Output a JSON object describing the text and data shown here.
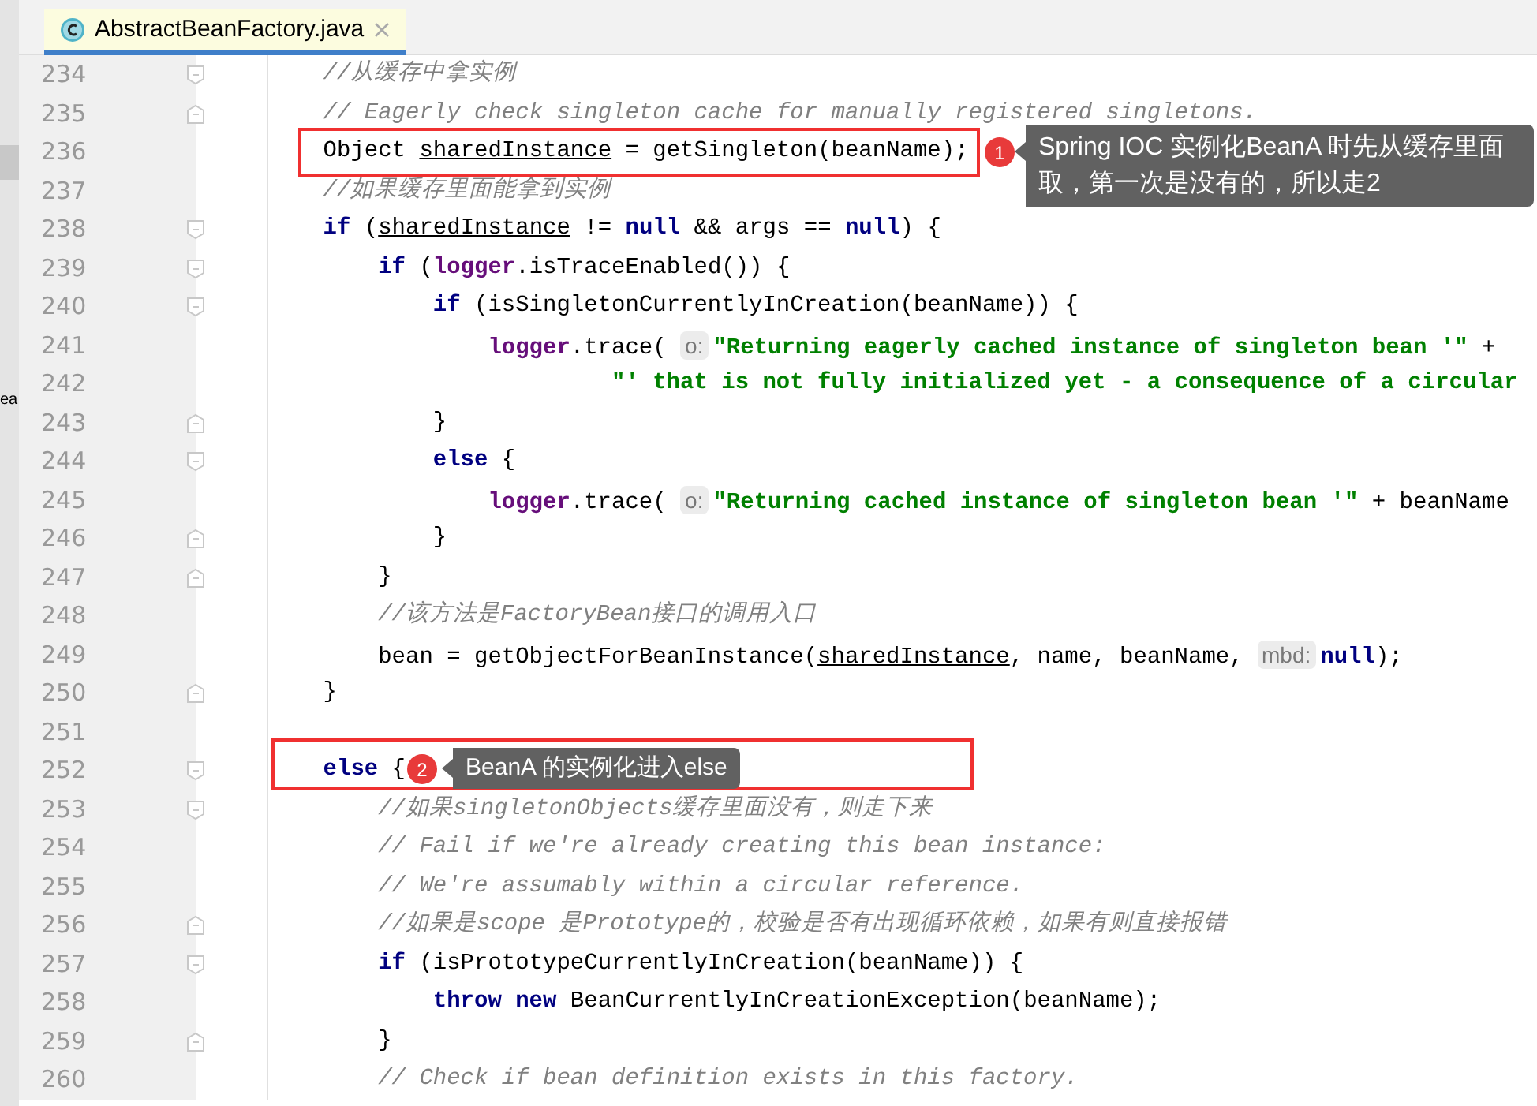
{
  "project_panel": {
    "text": "ea"
  },
  "tabs": [
    {
      "label": "AbstractBeanFactory.java",
      "selected": true
    }
  ],
  "lines": [
    {
      "number": "234",
      "kind": "block_start",
      "tokens": [
        {
          "kind": "comment",
          "text": "//从缓存中拿实例"
        }
      ]
    },
    {
      "number": "235",
      "kind": "block_end",
      "tokens": [
        {
          "kind": "comment",
          "text": "// Eagerly check singleton cache for manually registered singletons."
        }
      ]
    },
    {
      "number": "236",
      "kind": "code",
      "tokens": [
        {
          "kind": "plain",
          "text": "Object "
        },
        {
          "kind": "var",
          "text": "sharedInstance"
        },
        {
          "kind": "plain",
          "text": " = getSingleton(beanName);"
        }
      ]
    },
    {
      "number": "237",
      "kind": "code",
      "tokens": [
        {
          "kind": "comment",
          "text": "//如果缓存里面能拿到实例"
        }
      ]
    },
    {
      "number": "238",
      "kind": "block_start",
      "tokens": [
        {
          "kind": "keyword",
          "text": "if"
        },
        {
          "kind": "plain",
          "text": " ("
        },
        {
          "kind": "var",
          "text": "sharedInstance"
        },
        {
          "kind": "plain",
          "text": " != "
        },
        {
          "kind": "keyword",
          "text": "null"
        },
        {
          "kind": "plain",
          "text": " && args == "
        },
        {
          "kind": "keyword",
          "text": "null"
        },
        {
          "kind": "plain",
          "text": ") {"
        }
      ],
      "children": [
        {
          "number": "239",
          "kind": "block_start",
          "tokens": [
            {
              "kind": "keyword",
              "text": "if"
            },
            {
              "kind": "plain",
              "text": " ("
            },
            {
              "kind": "field",
              "text": "logger"
            },
            {
              "kind": "plain",
              "text": ".isTraceEnabled()) {"
            }
          ],
          "children": [
            {
              "number": "240",
              "kind": "block_start",
              "tokens": [
                {
                  "kind": "keyword",
                  "text": "if"
                },
                {
                  "kind": "plain",
                  "text": " (isSingletonCurrentlyInCreation(beanName)) {"
                }
              ],
              "children": [
                {
                  "number": "241",
                  "kind": "code",
                  "tokens": [
                    {
                      "kind": "field",
                      "text": "logger"
                    },
                    {
                      "kind": "plain",
                      "text": ".trace( "
                    },
                    {
                      "kind": "hint",
                      "text": "o:"
                    },
                    {
                      "kind": "string",
                      "text": "\"Returning eagerly cached instance of singleton bean '\""
                    },
                    {
                      "kind": "plain",
                      "text": " +"
                    }
                  ]
                },
                {
                  "number": "242",
                  "kind": "continuation",
                  "tokens": [
                    {
                      "kind": "string",
                      "text": "\"' that is not fully initialized yet - a consequence of a circular"
                    }
                  ]
                }
              ]
            },
            {
              "number": "243",
              "kind": "block_end",
              "tokens": [
                {
                  "kind": "plain",
                  "text": "}"
                }
              ]
            },
            {
              "number": "244",
              "kind": "block_start",
              "tokens": [
                {
                  "kind": "keyword",
                  "text": "else"
                },
                {
                  "kind": "plain",
                  "text": " {"
                }
              ],
              "children": [
                {
                  "number": "245",
                  "kind": "code",
                  "tokens": [
                    {
                      "kind": "field",
                      "text": "logger"
                    },
                    {
                      "kind": "plain",
                      "text": ".trace( "
                    },
                    {
                      "kind": "hint",
                      "text": "o:"
                    },
                    {
                      "kind": "string",
                      "text": "\"Returning cached instance of singleton bean '\""
                    },
                    {
                      "kind": "plain",
                      "text": " + beanName"
                    }
                  ]
                }
              ]
            },
            {
              "number": "246",
              "kind": "block_end",
              "tokens": [
                {
                  "kind": "plain",
                  "text": "}"
                }
              ]
            }
          ]
        },
        {
          "number": "247",
          "kind": "block_end",
          "tokens": [
            {
              "kind": "plain",
              "text": "}"
            }
          ]
        },
        {
          "number": "248",
          "kind": "code",
          "tokens": [
            {
              "kind": "comment",
              "text": "//该方法是FactoryBean接口的调用入口"
            }
          ]
        },
        {
          "number": "249",
          "kind": "code",
          "tokens": [
            {
              "kind": "plain",
              "text": "bean = getObjectForBeanInstance("
            },
            {
              "kind": "var",
              "text": "sharedInstance"
            },
            {
              "kind": "plain",
              "text": ", name, beanName, "
            },
            {
              "kind": "hint",
              "text": "mbd:"
            },
            {
              "kind": "keyword",
              "text": "null"
            },
            {
              "kind": "plain",
              "text": ");"
            }
          ]
        }
      ]
    },
    {
      "number": "250",
      "kind": "block_end",
      "tokens": [
        {
          "kind": "plain",
          "text": "}"
        }
      ]
    },
    {
      "number": "251",
      "kind": "code"
    },
    {
      "number": "252",
      "kind": "block_start",
      "tokens": [
        {
          "kind": "keyword",
          "text": "else"
        },
        {
          "kind": "plain",
          "text": " {"
        }
      ],
      "children": [
        {
          "number": "253",
          "kind": "block_start",
          "tokens": [
            {
              "kind": "comment",
              "text": "//如果singletonObjects缓存里面没有，则走下来"
            }
          ]
        },
        {
          "number": "254",
          "kind": "code",
          "tokens": [
            {
              "kind": "comment",
              "text": "// Fail if we're already creating this bean instance:"
            }
          ]
        },
        {
          "number": "255",
          "kind": "code",
          "tokens": [
            {
              "kind": "comment",
              "text": "// We're assumably within a circular reference."
            }
          ]
        },
        {
          "number": "256",
          "kind": "block_end",
          "tokens": [
            {
              "kind": "comment",
              "text": "//如果是scope 是Prototype的，校验是否有出现循环依赖，如果有则直接报错"
            }
          ]
        },
        {
          "number": "257",
          "kind": "block_start",
          "tokens": [
            {
              "kind": "keyword",
              "text": "if"
            },
            {
              "kind": "plain",
              "text": " (isPrototypeCurrentlyInCreation(beanName)) {"
            }
          ],
          "children": [
            {
              "number": "258",
              "kind": "code",
              "tokens": [
                {
                  "kind": "keyword",
                  "text": "throw new"
                },
                {
                  "kind": "plain",
                  "text": " BeanCurrentlyInCreationException(beanName);"
                }
              ]
            }
          ]
        },
        {
          "number": "259",
          "kind": "block_end",
          "tokens": [
            {
              "kind": "plain",
              "text": "}"
            }
          ]
        },
        {
          "number": "260",
          "kind": "code",
          "tokens": [
            {
              "kind": "comment",
              "text": "// Check if bean definition exists in this factory."
            }
          ]
        }
      ]
    }
  ],
  "annotations": [
    {
      "number": "1",
      "text": "Spring IOC 实例化BeanA 时先从缓存里面取，第一次是没有的，所以走2"
    },
    {
      "number": "2",
      "text": "BeanA 的实例化进入else"
    }
  ]
}
